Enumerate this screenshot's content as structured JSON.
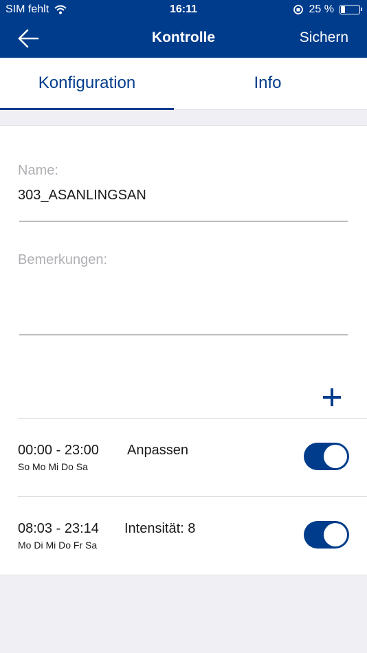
{
  "status_bar": {
    "carrier": "SIM fehlt",
    "time": "16:11",
    "battery_text": "25 %",
    "battery_level": 0.25
  },
  "nav": {
    "title": "Kontrolle",
    "save_label": "Sichern"
  },
  "tabs": [
    {
      "label": "Konfiguration",
      "active": true
    },
    {
      "label": "Info",
      "active": false
    }
  ],
  "form": {
    "name_label": "Name:",
    "name_value": "303_ASANLINGSAN",
    "remarks_label": "Bemerkungen:",
    "remarks_value": ""
  },
  "schedules": [
    {
      "time": "00:00 - 23:00",
      "action": "Anpassen",
      "days": "So Mo Mi Do Sa",
      "enabled": true
    },
    {
      "time": "08:03 - 23:14",
      "action": "Intensität: 8",
      "days": "Mo Di Mi Do Fr Sa",
      "enabled": true
    }
  ],
  "colors": {
    "brand": "#003c8c",
    "background": "#efeff4"
  }
}
